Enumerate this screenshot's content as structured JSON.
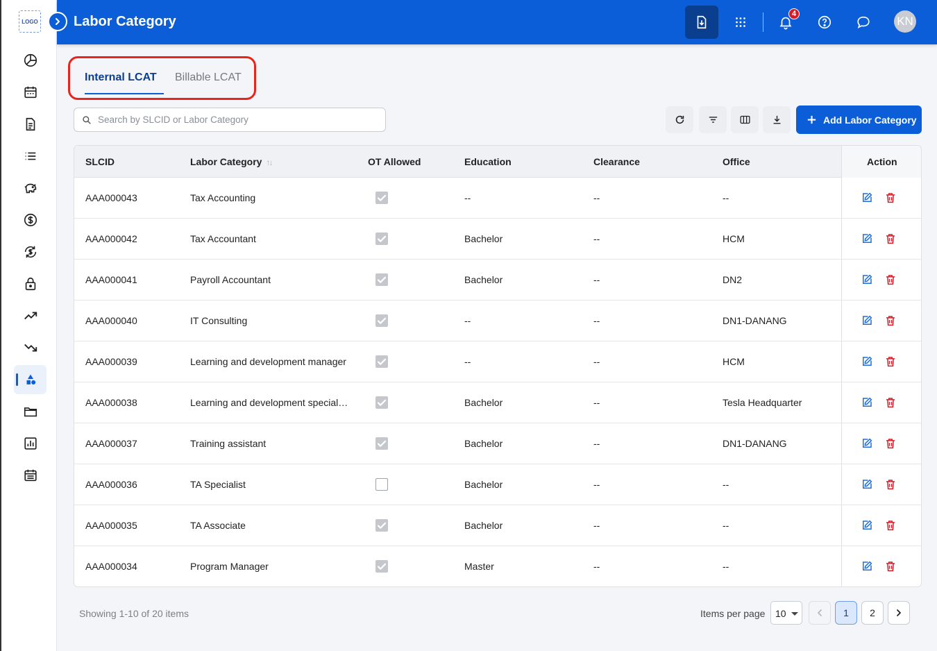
{
  "app": {
    "logo_text": "LOGO",
    "page_title": "Labor Category",
    "notification_count": "4",
    "avatar_initials": "KN"
  },
  "sidebar": {
    "items": [
      {
        "name": "dashboard",
        "icon": "pie-chart-icon"
      },
      {
        "name": "calendar",
        "icon": "calendar-icon"
      },
      {
        "name": "documents",
        "icon": "document-icon"
      },
      {
        "name": "list",
        "icon": "list-icon"
      },
      {
        "name": "budget",
        "icon": "piggy-bank-icon"
      },
      {
        "name": "billing",
        "icon": "dollar-icon"
      },
      {
        "name": "exchange",
        "icon": "dollar-sync-icon"
      },
      {
        "name": "security",
        "icon": "lock-icon"
      },
      {
        "name": "trending-up",
        "icon": "trend-up-icon"
      },
      {
        "name": "trending-down",
        "icon": "trend-down-icon"
      },
      {
        "name": "labor-category",
        "icon": "shapes-icon",
        "active": true
      },
      {
        "name": "folders",
        "icon": "folder-icon"
      },
      {
        "name": "reports",
        "icon": "bar-chart-icon"
      },
      {
        "name": "schedule",
        "icon": "calendar-list-icon"
      }
    ]
  },
  "tabs": [
    {
      "label": "Internal LCAT",
      "active": true
    },
    {
      "label": "Billable LCAT",
      "active": false
    }
  ],
  "search": {
    "placeholder": "Search by SLCID or Labor Category"
  },
  "toolbar": {
    "add_label": "Add Labor Category"
  },
  "table": {
    "headers": {
      "slcid": "SLCID",
      "category": "Labor Category",
      "ot": "OT Allowed",
      "education": "Education",
      "clearance": "Clearance",
      "office": "Office",
      "action": "Action"
    },
    "rows": [
      {
        "slcid": "AAA000043",
        "category": "Tax Accounting",
        "ot": true,
        "education": "--",
        "clearance": "--",
        "office": "--"
      },
      {
        "slcid": "AAA000042",
        "category": "Tax Accountant",
        "ot": true,
        "education": "Bachelor",
        "clearance": "--",
        "office": "HCM"
      },
      {
        "slcid": "AAA000041",
        "category": "Payroll Accountant",
        "ot": true,
        "education": "Bachelor",
        "clearance": "--",
        "office": "DN2"
      },
      {
        "slcid": "AAA000040",
        "category": "IT Consulting",
        "ot": true,
        "education": "--",
        "clearance": "--",
        "office": "DN1-DANANG"
      },
      {
        "slcid": "AAA000039",
        "category": "Learning and development manager",
        "ot": true,
        "education": "--",
        "clearance": "--",
        "office": "HCM"
      },
      {
        "slcid": "AAA000038",
        "category": "Learning and development special…",
        "ot": true,
        "education": "Bachelor",
        "clearance": "--",
        "office": "Tesla Headquarter"
      },
      {
        "slcid": "AAA000037",
        "category": "Training assistant",
        "ot": true,
        "education": "Bachelor",
        "clearance": "--",
        "office": "DN1-DANANG"
      },
      {
        "slcid": "AAA000036",
        "category": "TA Specialist",
        "ot": false,
        "education": "Bachelor",
        "clearance": "--",
        "office": "--"
      },
      {
        "slcid": "AAA000035",
        "category": "TA Associate",
        "ot": true,
        "education": "Bachelor",
        "clearance": "--",
        "office": "--"
      },
      {
        "slcid": "AAA000034",
        "category": "Program Manager",
        "ot": true,
        "education": "Master",
        "clearance": "--",
        "office": "--"
      }
    ]
  },
  "footer": {
    "showing": "Showing 1-10 of 20 items",
    "items_per_page_label": "Items per page",
    "items_per_page": "10",
    "pages": [
      "1",
      "2"
    ],
    "current_page": "1"
  },
  "colors": {
    "primary": "#0b5ed7",
    "danger": "#d81b28",
    "highlight": "#e8241c"
  }
}
